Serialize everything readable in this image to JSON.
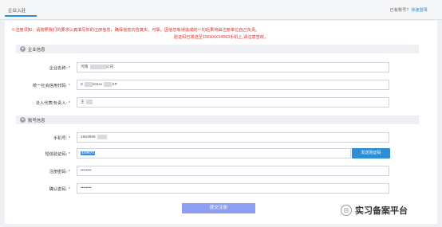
{
  "header": {
    "tab": "企业入驻",
    "account_prompt": "已有账号?",
    "login_link": "快速登录"
  },
  "notice": {
    "line1": "※注册须知：请按照我们的要求认真填写你的注册信息，确保信息内容真实、可靠。因信息有误造成的一切后果将由注册单位自己负责。",
    "line2": "验证码已发送至156XXXX4563手机上,请注意查收。"
  },
  "sections": {
    "company": "企业信息",
    "account": "账号信息"
  },
  "fields": {
    "company_name": {
      "label": "企业名称:",
      "value_a": "河南",
      "value_b": "公司"
    },
    "credit_code": {
      "label": "统一社会信用代码:",
      "value_a": "9",
      "value_b": "104xx",
      "value_c": "KP"
    },
    "legal_rep": {
      "label": "法人代表/负责人:",
      "value": "王"
    },
    "phone": {
      "label": "手机号:",
      "value": "1563986"
    },
    "sms_code": {
      "label": "短信验证码:",
      "value": "449670"
    },
    "password": {
      "label": "注册密码:",
      "value": "••••••••"
    },
    "confirm_password": {
      "label": "确认密码:",
      "value": "••••••••"
    }
  },
  "required_mark": "*",
  "buttons": {
    "send_code": "发送验证码",
    "submit": "提交注册"
  },
  "watermark": {
    "text": "实习备案平台"
  }
}
